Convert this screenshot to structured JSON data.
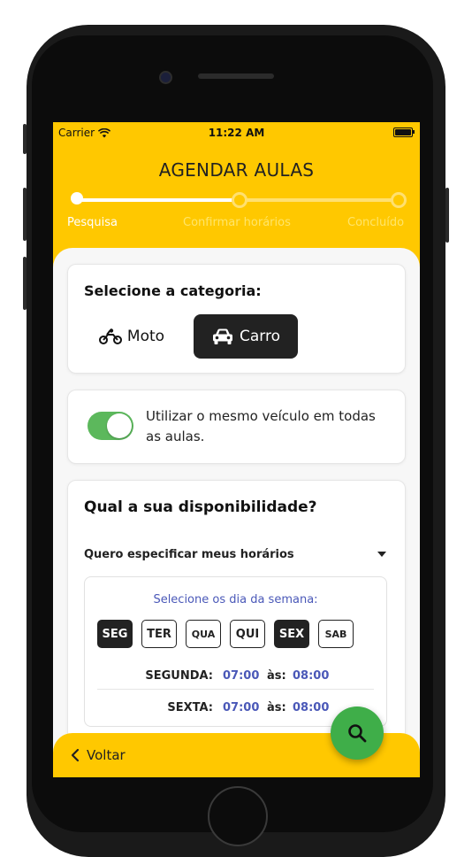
{
  "status_bar": {
    "carrier": "Carrier",
    "time": "11:22 AM"
  },
  "header": {
    "title": "AGENDAR AULAS"
  },
  "steps": [
    {
      "label": "Pesquisa",
      "active": true
    },
    {
      "label": "Confirmar horários",
      "active": false
    },
    {
      "label": "Concluído",
      "active": false
    }
  ],
  "category": {
    "title": "Selecione a categoria:",
    "options": [
      {
        "label": "Moto",
        "icon": "motorcycle-icon",
        "selected": false
      },
      {
        "label": "Carro",
        "icon": "car-icon",
        "selected": true
      }
    ]
  },
  "same_vehicle": {
    "label": "Utilizar o mesmo veículo em todas as aulas.",
    "enabled": true
  },
  "availability": {
    "title": "Qual a sua disponibilidade?",
    "dropdown_value": "Quero especificar meus horários",
    "days_title": "Selecione os dia da semana:",
    "days": [
      {
        "label": "SEG",
        "selected": true
      },
      {
        "label": "TER",
        "selected": false
      },
      {
        "label": "QUA",
        "selected": false
      },
      {
        "label": "QUI",
        "selected": false
      },
      {
        "label": "SEX",
        "selected": true
      },
      {
        "label": "SAB",
        "selected": false
      }
    ],
    "schedule": [
      {
        "day": "SEGUNDA:",
        "from": "07:00",
        "sep": "às:",
        "to": "08:00"
      },
      {
        "day": "SEXTA:",
        "from": "07:00",
        "sep": "às:",
        "to": "08:00"
      }
    ]
  },
  "footer": {
    "back_label": "Voltar",
    "fab_icon": "search-icon"
  },
  "colors": {
    "primary": "#FFC800",
    "dark": "#222222",
    "accent_blue": "#4A58B8",
    "green": "#3FAE49",
    "toggle_green": "#5CB85C"
  }
}
